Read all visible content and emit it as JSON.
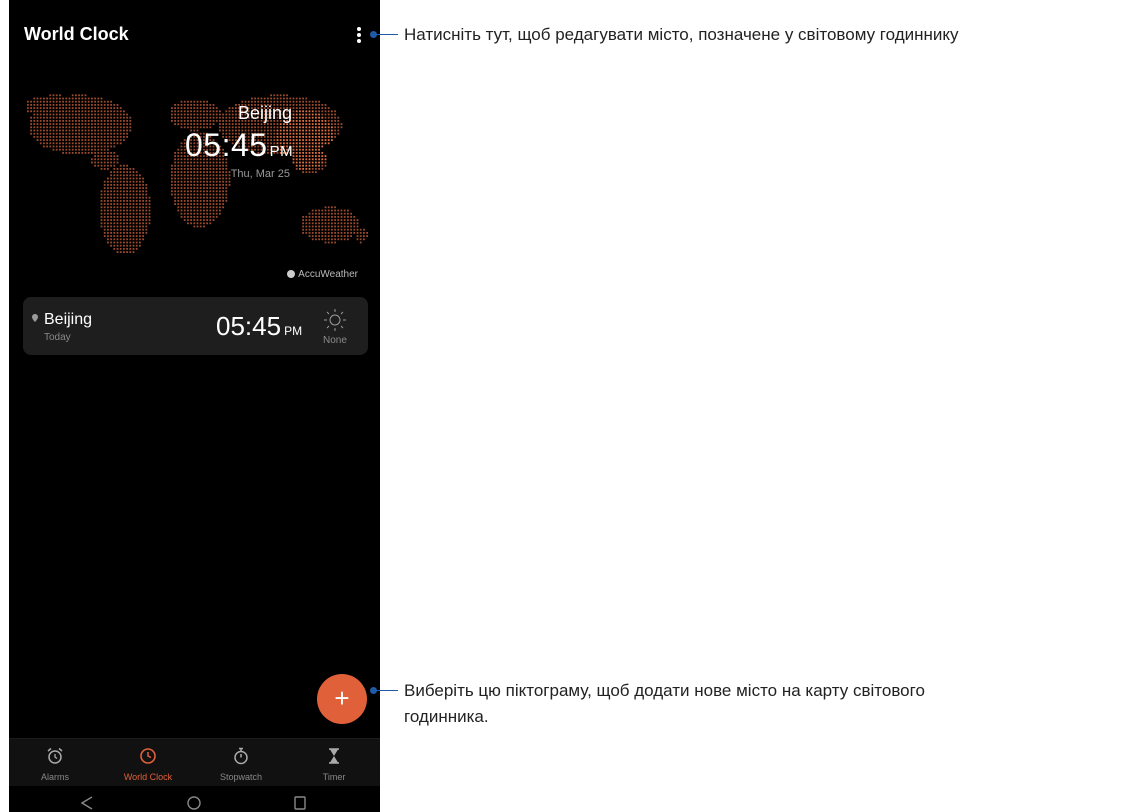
{
  "header": {
    "title": "World Clock",
    "more_icon": "more-vertical-icon"
  },
  "map_clock": {
    "city": "Beijing",
    "time": "05:45",
    "ampm": "PM",
    "date": "Thu, Mar 25",
    "brand": "AccuWeather"
  },
  "city_card": {
    "city": "Beijing",
    "day": "Today",
    "time": "05:45",
    "ampm": "PM",
    "weather": "None",
    "weather_icon": "sun-icon"
  },
  "fab": {
    "label": "+"
  },
  "bottom_nav": {
    "items": [
      {
        "label": "Alarms",
        "icon": "alarm-clock-icon"
      },
      {
        "label": "World Clock",
        "icon": "clock-icon"
      },
      {
        "label": "Stopwatch",
        "icon": "stopwatch-icon"
      },
      {
        "label": "Timer",
        "icon": "hourglass-icon"
      }
    ],
    "active_index": 1
  },
  "callouts": {
    "edit": "Натисніть тут, щоб редагувати місто, позначене у світовому годиннику",
    "add_line1": "Виберіть цю піктограму, щоб додати нове місто на карту світового",
    "add_line2": "годинника."
  },
  "colors": {
    "accent": "#e0603a",
    "callout": "#1f5aa6",
    "map_dots": "#9c4a2c",
    "map_highlight": "#e07040"
  }
}
